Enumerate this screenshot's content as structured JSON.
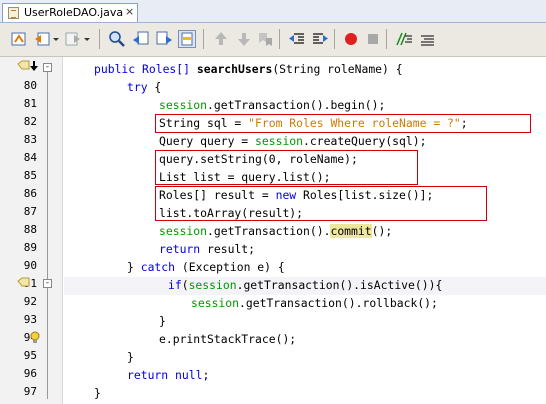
{
  "tab": {
    "title": "UserRoleDAO.java",
    "close": "×"
  },
  "toolbar": {
    "icons": [
      "history-icon",
      "back-icon",
      "dropdown-icon",
      "forward-icon",
      "dropdown-icon",
      "find-icon",
      "find-prev-icon",
      "find-next-icon",
      "toggle-highlight-icon",
      "prev-bookmark-icon",
      "next-bookmark-icon",
      "toggle-bookmark-icon",
      "shift-left-icon",
      "shift-right-icon",
      "record-macro-icon",
      "stop-macro-icon",
      "comment-icon",
      "uncomment-icon"
    ]
  },
  "gutter": {
    "line_numbers": [
      "80",
      "81",
      "82",
      "83",
      "84",
      "85",
      "86",
      "87",
      "88",
      "89",
      "90",
      "91",
      "92",
      "93",
      "94",
      "95",
      "96",
      "97"
    ]
  },
  "code": {
    "l79_a": "public Roles[] ",
    "l79_b": "searchUsers",
    "l79_c": "(String roleName) {",
    "l80_a": "try",
    "l80_b": " {",
    "l81_a": "session",
    "l81_b": ".getTransaction().begin();",
    "l82_a": "String sql = ",
    "l82_b": "\"From Roles Where roleName = ?\"",
    "l82_c": ";",
    "l83_a": "Query query = ",
    "l83_b": "session",
    "l83_c": ".createQuery(sql);",
    "l84": "query.setString(0, roleName);",
    "l85": "List list = query.list();",
    "l86_a": "Roles[] result = ",
    "l86_b": "new",
    "l86_c": " Roles[list.size()];",
    "l87": "list.toArray(result);",
    "l88_a": "session",
    "l88_b": ".getTransaction().",
    "l88_c": "commit",
    "l88_d": "();",
    "l89_a": "return",
    "l89_b": " result;",
    "l90_a": "} ",
    "l90_b": "catch",
    "l90_c": " (Exception e) {",
    "l91_a": "if",
    "l91_b": "(",
    "l91_c": "session",
    "l91_d": ".getTransaction().isActive()){",
    "l92_a": "session",
    "l92_b": ".getTransaction().rollback();",
    "l93": "}",
    "l94": "e.printStackTrace();",
    "l95": "}",
    "l96_a": "return",
    "l96_b": " null",
    "l96_c": ";",
    "l97": "}"
  },
  "colors": {
    "keyword": "#0000e6",
    "field": "#009900",
    "string": "#ce7b00",
    "highlight_box": "#d00000"
  }
}
